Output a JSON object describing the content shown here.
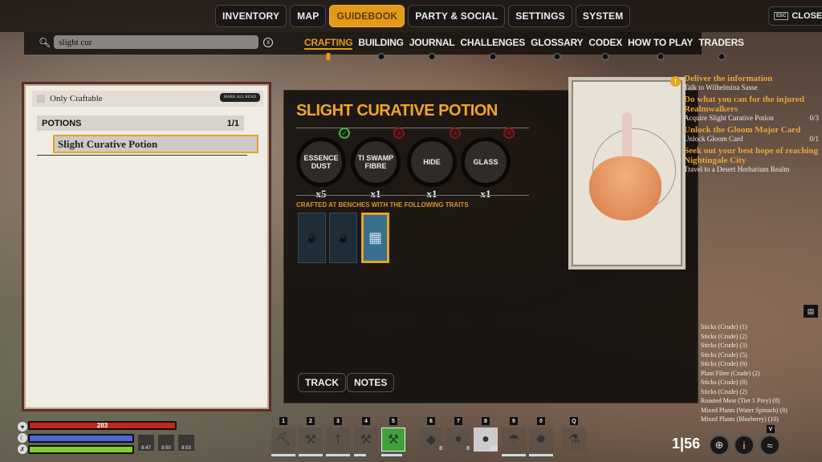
{
  "main_nav": [
    {
      "label": "INVENTORY",
      "active": false
    },
    {
      "label": "MAP",
      "active": false
    },
    {
      "label": "GUIDEBOOK",
      "active": true
    },
    {
      "label": "PARTY & SOCIAL",
      "active": false
    },
    {
      "label": "SETTINGS",
      "active": false
    },
    {
      "label": "SYSTEM",
      "active": false
    }
  ],
  "close": {
    "key": "ESC",
    "label": "CLOSE"
  },
  "search": {
    "value": "slight cur",
    "clear_icon": "clear-x-icon"
  },
  "sub_nav": [
    "CRAFTING",
    "BUILDING",
    "JOURNAL",
    "CHALLENGES",
    "GLOSSARY",
    "CODEX",
    "HOW TO PLAY",
    "TRADERS"
  ],
  "sub_nav_active": "CRAFTING",
  "left": {
    "only_craftable": "Only Craftable",
    "mark_all_read": "MARK ALL READ",
    "category": {
      "name": "POTIONS",
      "count": "1/1"
    },
    "selected_recipe": "Slight Curative Potion"
  },
  "recipe": {
    "title": "SLIGHT CURATIVE POTION",
    "ingredients": [
      {
        "name": "ESSENCE DUST",
        "qty": "x5",
        "status": "ok"
      },
      {
        "name": "TI SWAMP FIBRE",
        "qty": "x1",
        "status": "missing"
      },
      {
        "name": "HIDE",
        "qty": "x1",
        "status": "missing"
      },
      {
        "name": "GLASS",
        "qty": "x1",
        "status": "missing"
      }
    ],
    "bench_label": "CRAFTED AT BENCHES WITH THE FOLLOWING TRAITS",
    "benches": [
      {
        "state": "locked"
      },
      {
        "state": "locked"
      },
      {
        "state": "unlocked"
      }
    ],
    "track": "TRACK",
    "notes": "NOTES"
  },
  "quests": [
    {
      "title": "Deliver the information",
      "steps": [
        {
          "text": "Talk to Wilhelmina Sasse",
          "progress": ""
        }
      ]
    },
    {
      "title": "Do what you can for the injured Realmwalkers",
      "steps": [
        {
          "text": "Acquire Slight Curative Potion",
          "progress": "0/3"
        }
      ]
    },
    {
      "title": "Unlock the Gloom Major Card",
      "steps": [
        {
          "text": "Unlock Gloom Card",
          "progress": "0/1"
        }
      ]
    },
    {
      "title": "Seek out your best hope of reaching Nightingale City",
      "steps": [
        {
          "text": "Travel to a Desert Herbarium Realm",
          "progress": ""
        }
      ]
    }
  ],
  "loot_log": [
    "Sticks (Crude) (1)",
    "Sticks (Crude) (2)",
    "Sticks (Crude) (3)",
    "Sticks (Crude) (5)",
    "Sticks (Crude) (6)",
    "Plant Fibre (Crude) (2)",
    "Sticks (Crude) (8)",
    "Sticks (Crude) (2)",
    "Roasted Meat (Tier 1 Prey) (8)",
    "Mixed Plants (Water Spinach) (8)",
    "Mixed Plants (Blueberry) (10)"
  ],
  "player": {
    "health": "283",
    "health_fill": 1.0,
    "stamina_fill": 0.98,
    "energy_fill": 0.98,
    "buffs": [
      {
        "time": "8:47"
      },
      {
        "time": "8:50"
      },
      {
        "time": "8:53"
      }
    ]
  },
  "hotbar": [
    {
      "key": "1",
      "item": "pickaxe",
      "durability": 1.0
    },
    {
      "key": "2",
      "item": "axe",
      "durability": 1.0
    },
    {
      "key": "3",
      "item": "machete",
      "durability": 1.0
    },
    {
      "key": "4",
      "item": "hammer",
      "durability": 0.5
    },
    {
      "key": "5",
      "item": "tool",
      "durability": 0.85,
      "selected": true
    },
    {
      "key": "6",
      "item": "ore",
      "count": "8"
    },
    {
      "key": "7",
      "item": "stone",
      "count": "8"
    },
    {
      "key": "8",
      "item": "stone",
      "count": "10",
      "highlight": true
    },
    {
      "key": "9",
      "item": "umbrella",
      "durability": 1.0
    },
    {
      "key": "0",
      "item": "torch",
      "durability": 1.0
    },
    {
      "key": "Q",
      "item": "potion"
    }
  ],
  "clock": {
    "hour": "1",
    "minute": "56"
  },
  "hud_key": "V"
}
